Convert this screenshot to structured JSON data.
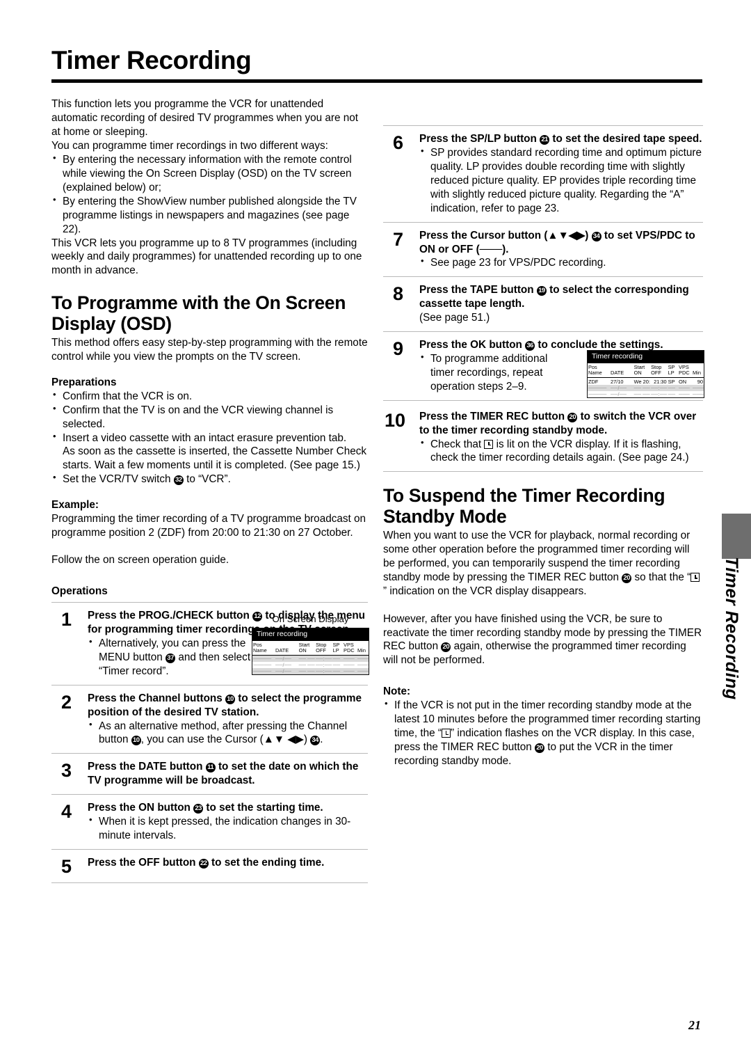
{
  "page": {
    "title": "Timer Recording",
    "page_number": "21",
    "side_tab_label": "Timer Recording"
  },
  "intro": {
    "paragraph_1": "This function lets you programme the VCR for unattended automatic recording of desired TV programmes when you are not at home or sleeping.",
    "paragraph_2": "You can programme timer recordings in two different ways:",
    "bullets": [
      "By entering the necessary information with the remote control while viewing the On Screen Display (OSD) on the TV screen (explained below) or;",
      "By entering the ShowView number published alongside the TV programme listings in newspapers and magazines (see page 22)."
    ],
    "paragraph_3": "This VCR lets you programme up to 8 TV programmes (including weekly and daily programmes) for unattended recording up to one month in advance."
  },
  "osd_section": {
    "heading": "To Programme with the On Screen Display (OSD)",
    "intro": "This method offers easy step-by-step programming with the remote control while you view the prompts on the TV screen.",
    "preparations_heading": "Preparations",
    "preparations": [
      {
        "text": "Confirm that the VCR is on."
      },
      {
        "text": "Confirm that the TV is on and the VCR viewing channel is selected."
      },
      {
        "text": "Insert a video cassette with an intact erasure prevention tab.",
        "cont": "As soon as the cassette is inserted, the Cassette Number Check starts. Wait a few moments until it is completed. (See page 15.)"
      },
      {
        "pre": "Set the VCR/TV switch ",
        "badge": "32",
        "post": " to “VCR”."
      }
    ],
    "example_heading": "Example:",
    "example_text": "Programming the timer recording of a TV programme broadcast on programme position 2 (ZDF) from 20:00 to 21:30 on 27 October.",
    "follow_text": "Follow the on screen operation guide.",
    "operations_heading": "Operations"
  },
  "steps": {
    "s1": {
      "num": "1",
      "head_pre": "Press the PROG./CHECK button ",
      "head_badge": "12",
      "head_post": " to display the menu for programming timer recordings on the TV screen.",
      "bullet_pre": "Alternatively, you can press the MENU button ",
      "bullet_badge": "37",
      "bullet_post": " and then select “Timer record”."
    },
    "s2": {
      "num": "2",
      "head_pre": "Press the Channel buttons ",
      "head_badge": "10",
      "head_post": " to select the programme position of the desired TV station.",
      "bullet_pre": "As an alternative method, after pressing the Channel button ",
      "bullet_badge": "10",
      "bullet_mid": ", you can use the Cursor (▲▼ ◀▶) ",
      "bullet_badge2": "34",
      "bullet_post": "."
    },
    "s3": {
      "num": "3",
      "head_pre": "Press the DATE button ",
      "head_badge": "11",
      "head_post": " to set the date on which the TV programme will be broadcast."
    },
    "s4": {
      "num": "4",
      "head_pre": "Press the ON button ",
      "head_badge": "23",
      "head_post": " to set the starting time.",
      "bullet": "When it is kept pressed, the indication changes in 30-minute intervals."
    },
    "s5": {
      "num": "5",
      "head_pre": "Press the OFF button ",
      "head_badge": "22",
      "head_post": " to set the ending time."
    },
    "s6": {
      "num": "6",
      "head_pre": "Press the SP/LP button ",
      "head_badge": "21",
      "head_post": " to set the desired tape speed.",
      "bullet": "SP provides standard recording time and optimum picture quality.",
      "bullet_cont_1": "LP provides double recording time with slightly reduced picture quality.",
      "bullet_cont_2": "EP provides triple recording time with slightly reduced picture quality.",
      "bullet_cont_3": "Regarding the “A” indication, refer to page 23."
    },
    "s7": {
      "num": "7",
      "head_pre": "Press the Cursor button (▲▼◀▶) ",
      "head_badge": "34",
      "head_post": " to set VPS/PDC to ON or OFF (───).",
      "bullet": "See page 23 for VPS/PDC recording."
    },
    "s8": {
      "num": "8",
      "head_pre": "Press the TAPE button ",
      "head_badge": "19",
      "head_post": " to select the corresponding cassette tape length.",
      "sub": "(See page 51.)"
    },
    "s9": {
      "num": "9",
      "head_pre": "Press the OK button ",
      "head_badge": "36",
      "head_post": " to conclude the settings.",
      "bullet": "To programme additional timer recordings, repeat operation steps 2–9."
    },
    "s10": {
      "num": "10",
      "head_pre": "Press the TIMER REC button ",
      "head_badge": "20",
      "head_post": " to switch the VCR over to the timer recording standby mode.",
      "bullet_pre": "Check that ",
      "bullet_post": " is lit on the VCR display.",
      "bullet_cont": "If it is flashing, check the timer recording details again. (See page 24.)"
    }
  },
  "suspend": {
    "heading": "To Suspend the Timer Recording Standby Mode",
    "para1_pre": "When you want to use the VCR for playback, normal recording or some other operation before the programmed timer recording will be performed, you can temporarily suspend the timer recording standby mode by pressing the TIMER REC button ",
    "para1_badge": "20",
    "para1_mid": " so that the “",
    "para1_post": "” indication on the VCR display disappears.",
    "para2_pre": "However, after you have finished using the VCR, be sure to reactivate the timer recording standby mode by pressing the TIMER REC button ",
    "para2_badge": "20",
    "para2_post": " again, otherwise the programmed timer recording will not be performed."
  },
  "note": {
    "heading": "Note:",
    "bullet_pre": "If the VCR is not put in the timer recording standby mode at the latest 10 minutes before the programmed timer recording starting time, the “",
    "bullet_mid": "” indication flashes on the VCR display. In this case, press the TIMER REC button ",
    "bullet_badge": "20",
    "bullet_post": " to put the VCR in the timer recording standby mode."
  },
  "osd_screen": {
    "caption": "On Screen Display",
    "title": "Timer recording",
    "headers_row1": [
      "Pos",
      "",
      "Start",
      "Stop",
      "SP",
      "VPS",
      ""
    ],
    "headers_row2": [
      "Name",
      "DATE",
      "ON",
      "OFF",
      "LP",
      "PDC",
      "Min"
    ],
    "empty_row": [
      "─────",
      "──/──",
      "── ──:──",
      "──:──",
      "──",
      "───",
      "───"
    ],
    "filled_row": [
      "ZDF",
      "27/10",
      "We 20:00",
      "21:30",
      "SP",
      "ON",
      "90"
    ]
  }
}
